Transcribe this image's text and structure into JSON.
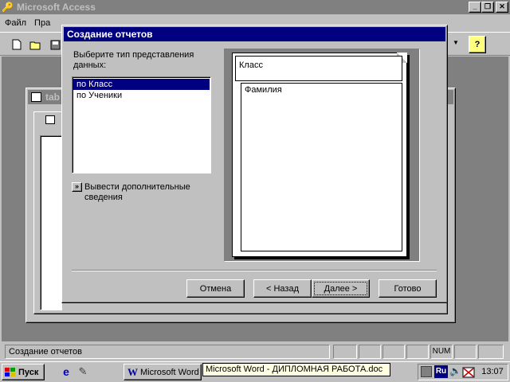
{
  "app": {
    "title": "Microsoft Access",
    "minimize_glyph": "_",
    "restore_glyph": "❐",
    "close_glyph": "✕"
  },
  "menubar": {
    "items": [
      "Файл",
      "Пра"
    ]
  },
  "toolbar": {
    "help_glyph": "?"
  },
  "bg_window": {
    "title_fragment": "tab"
  },
  "dialog": {
    "title": "Создание отчетов",
    "prompt": "Выберите тип представления данных:",
    "list_items": [
      "по Класс",
      "по Ученики"
    ],
    "selected_index": 0,
    "more_button_glyph": "»",
    "more_label": "Вывести дополнительные сведения",
    "preview": {
      "group_field": "Класс",
      "detail_field": "Фамилия"
    },
    "buttons": {
      "cancel": "Отмена",
      "back": "< Назад",
      "next": "Далее >",
      "finish": "Готово"
    }
  },
  "statusbar": {
    "text": "Создание отчетов",
    "num": "NUM"
  },
  "taskbar": {
    "start_label": "Пуск",
    "task_word_label": "Microsoft Word",
    "tooltip": "Microsoft Word - ДИПЛОМНАЯ   РАБОТА.doc",
    "lang": "Ru",
    "clock": "13:07"
  },
  "colors": {
    "face": "#c0c0c0",
    "active_title": "#000080",
    "inactive_title": "#808080",
    "desktop_mdi": "#808080",
    "tooltip_bg": "#ffffe1"
  }
}
